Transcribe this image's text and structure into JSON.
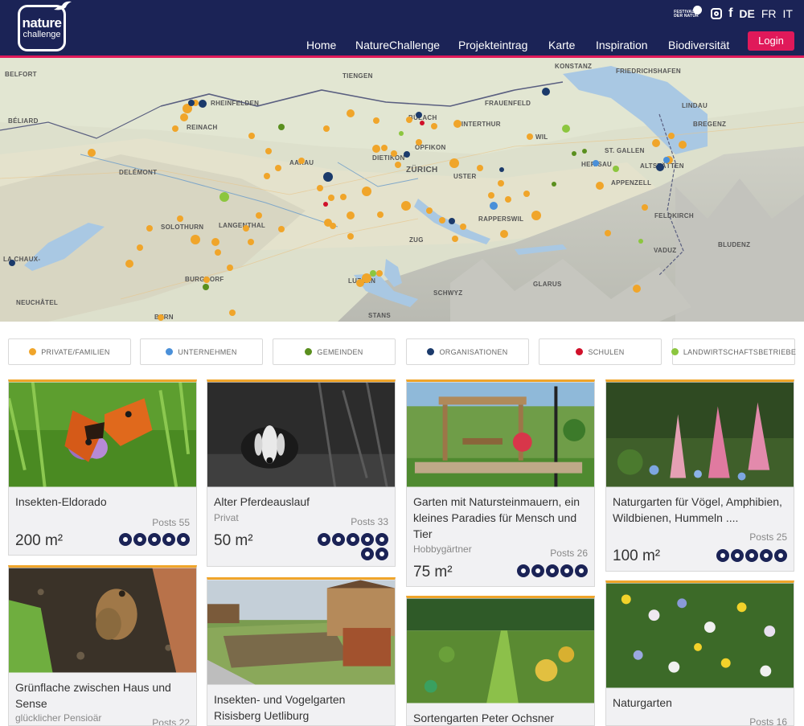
{
  "header": {
    "logo": {
      "line1": "nature",
      "line2": "challenge"
    },
    "festival_logo": {
      "line1": "FESTIVAL",
      "line2": "DER NATUR"
    },
    "languages": [
      "DE",
      "FR",
      "IT"
    ],
    "active_language": "DE",
    "nav": [
      "Home",
      "NatureChallenge",
      "Projekteintrag",
      "Karte",
      "Inspiration",
      "Biodiversität"
    ],
    "login_label": "Login"
  },
  "map": {
    "labels": {
      "belfort": "BELFORT",
      "rheinfelden": "RHEINFELDEN",
      "tiengen": "TIENGEN",
      "konstanz": "KONSTANZ",
      "friedrichshafen": "FRIEDRICHSHAFEN",
      "frauenfeld": "FRAUENFELD",
      "buelach": "BÜLACH",
      "winterthur": "WINTERTHUR",
      "lindau": "LINDAU",
      "bregenz": "BREGENZ",
      "beliard": "BÉLIARD",
      "reinach": "REINACH",
      "opfikon": "OPFIKON",
      "wil": "WIL",
      "stgallen": "ST. GALLEN",
      "delemont": "DELÉMONT",
      "aarau": "AARAU",
      "dietikon": "DIETIKON",
      "zurich": "ZÜRICH",
      "uster": "USTER",
      "herisau": "HERISAU",
      "altstaetten": "ALTSTÄTTEN",
      "appenzell": "APPENZELL",
      "solothurn": "SOLOTHURN",
      "langenthal": "LANGENTHAL",
      "rapperswil": "RAPPERSWIL",
      "feldkirch": "FELDKIRCH",
      "zug": "ZUG",
      "vaduz": "VADUZ",
      "bludenz": "BLUDENZ",
      "chauxdefonds": "LA CHAUX-",
      "burgdorf": "BURGDORF",
      "luzern": "LUZERN",
      "schwyz": "SCHWYZ",
      "glarus": "GLARUS",
      "neuchatel": "NEUCHÂTEL",
      "stans": "STANS",
      "bern": "BERN"
    },
    "marker_colors": {
      "private": "#f0a52a",
      "company": "#4a90d9",
      "community": "#5a8f1e",
      "organisation": "#1b3a6b",
      "school": "#d0102a",
      "farm": "#8cc63f"
    }
  },
  "legend": [
    {
      "label": "PRIVATE/FAMILIEN",
      "color": "#f0a52a"
    },
    {
      "label": "UNTERNEHMEN",
      "color": "#4a90d9"
    },
    {
      "label": "GEMEINDEN",
      "color": "#5a8f1e"
    },
    {
      "label": "ORGANISATIONEN",
      "color": "#1b3a6b"
    },
    {
      "label": "SCHULEN",
      "color": "#d0102a"
    },
    {
      "label": "LANDWIRTSCHAFTSBETRIEBE",
      "color": "#8cc63f"
    }
  ],
  "cards": [
    {
      "title": "Insekten-Eldorado",
      "subtitle": "",
      "posts": "Posts 55",
      "area": "200 m²",
      "icons": [
        "bee-icon",
        "flower-icon",
        "leaf-icon",
        "bird-icon",
        "snowflake-icon"
      ]
    },
    {
      "title": "Alter Pferdeauslauf",
      "subtitle": "Privat",
      "posts": "Posts 33",
      "area": "50 m²",
      "icons": [
        "more-icon",
        "bird-icon",
        "leaf-icon",
        "flower-icon",
        "bee-icon",
        "frog-icon",
        "snowflake-icon"
      ]
    },
    {
      "title": "Garten mit Natursteinmauern, ein kleines Paradies für Mensch und Tier",
      "subtitle": "Hobbygärtner",
      "posts": "Posts 26",
      "area": "75 m²",
      "icons": [
        "flower-icon",
        "leaf-icon",
        "snowflake-icon",
        "bee-icon",
        "bird-icon"
      ]
    },
    {
      "title": "Naturgarten für Vögel, Amphibien, Wildbienen, Hummeln ....",
      "subtitle": "",
      "posts": "Posts 25",
      "area": "100 m²",
      "icons": [
        "bird-icon",
        "bird-icon",
        "snowflake-icon",
        "flower-icon",
        "bee-icon"
      ]
    },
    {
      "title": "Grünflache zwischen Haus und Sense",
      "subtitle": "glücklicher Pensioär",
      "posts": "Posts 22",
      "area": "",
      "icons": []
    },
    {
      "title": "Insekten- und Vogelgarten Risisberg Uetliburg",
      "subtitle": "",
      "posts": "",
      "area": "",
      "icons": []
    },
    {
      "title": "Sortengarten Peter Ochsner",
      "subtitle": "",
      "posts": "",
      "area": "",
      "icons": []
    },
    {
      "title": "Naturgarten",
      "subtitle": "",
      "posts": "Posts 16",
      "area": "",
      "icons": []
    }
  ]
}
